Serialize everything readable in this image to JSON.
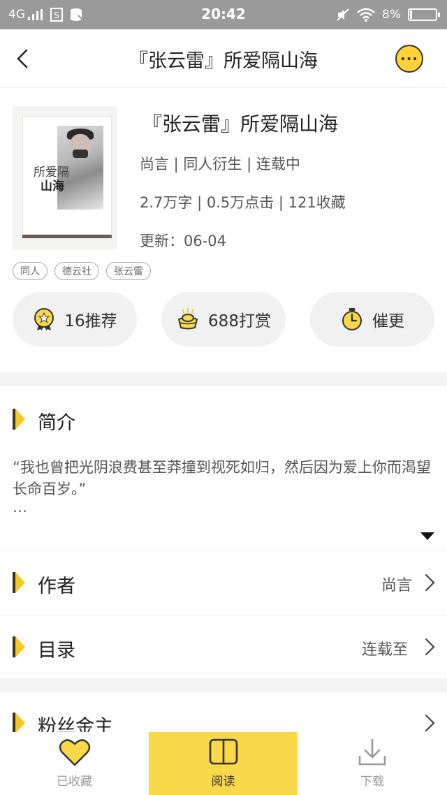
{
  "status_bar": {
    "network": "4G",
    "time": "20:42",
    "battery_percent": "8%",
    "battery_level": 0.08,
    "icons": [
      "signal-icon",
      "sim-icon",
      "storage-icon",
      "mute-icon",
      "wifi-icon",
      "battery-icon"
    ]
  },
  "header": {
    "title": "『张云雷』所爱隔山海",
    "more_label": "···"
  },
  "book": {
    "cover_text_1": "所爱隔",
    "cover_text_2": "山海",
    "title": "『张云雷』所爱隔山海",
    "meta_line1": "尚言 | 同人衍生 | 连载中",
    "meta_line2": "2.7万字 | 0.5万点击 | 121收藏",
    "meta_line3": "更新：06-04",
    "tags": [
      "同人",
      "德云社",
      "张云雷"
    ]
  },
  "actions": {
    "recommend": "16推荐",
    "reward": "688打赏",
    "urge": "催更"
  },
  "intro": {
    "title": "简介",
    "text": "“我也曾把光阴浪费甚至莽撞到视死如归，然后因为爱上你而渴望长命百岁。”",
    "ellipsis": "…"
  },
  "author_row": {
    "label": "作者",
    "value": "尚言"
  },
  "toc_row": {
    "label": "目录",
    "value": "连载至"
  },
  "fans_row": {
    "label": "粉丝金主"
  },
  "bottom_bar": {
    "favorite": "已收藏",
    "read": "阅读",
    "download": "下载"
  },
  "colors": {
    "accent_yellow": "#f9d84a",
    "status_bar_gray": "#9a9a9a"
  }
}
